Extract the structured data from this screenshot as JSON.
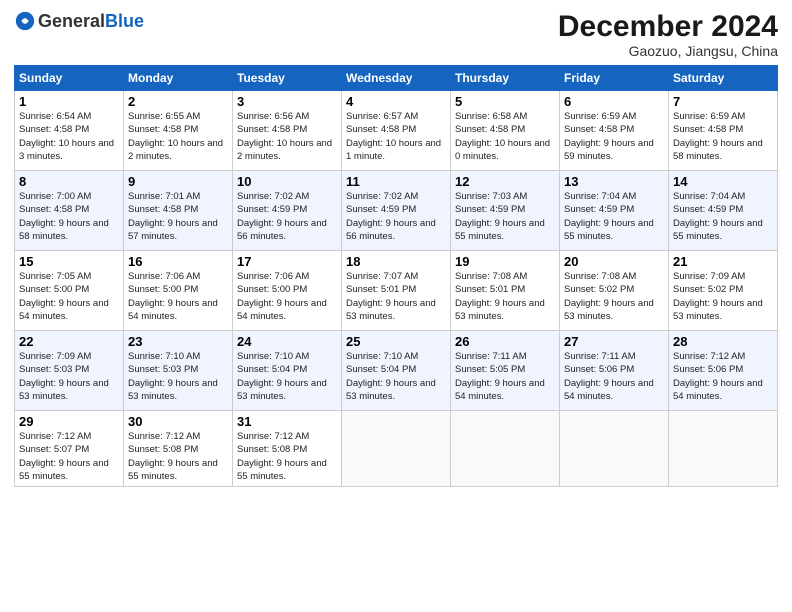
{
  "header": {
    "logo_general": "General",
    "logo_blue": "Blue",
    "month_title": "December 2024",
    "location": "Gaozuo, Jiangsu, China"
  },
  "weekdays": [
    "Sunday",
    "Monday",
    "Tuesday",
    "Wednesday",
    "Thursday",
    "Friday",
    "Saturday"
  ],
  "weeks": [
    [
      {
        "day": 1,
        "sunrise": "6:54 AM",
        "sunset": "4:58 PM",
        "daylight": "10 hours and 3 minutes."
      },
      {
        "day": 2,
        "sunrise": "6:55 AM",
        "sunset": "4:58 PM",
        "daylight": "10 hours and 2 minutes."
      },
      {
        "day": 3,
        "sunrise": "6:56 AM",
        "sunset": "4:58 PM",
        "daylight": "10 hours and 2 minutes."
      },
      {
        "day": 4,
        "sunrise": "6:57 AM",
        "sunset": "4:58 PM",
        "daylight": "10 hours and 1 minute."
      },
      {
        "day": 5,
        "sunrise": "6:58 AM",
        "sunset": "4:58 PM",
        "daylight": "10 hours and 0 minutes."
      },
      {
        "day": 6,
        "sunrise": "6:59 AM",
        "sunset": "4:58 PM",
        "daylight": "9 hours and 59 minutes."
      },
      {
        "day": 7,
        "sunrise": "6:59 AM",
        "sunset": "4:58 PM",
        "daylight": "9 hours and 58 minutes."
      }
    ],
    [
      {
        "day": 8,
        "sunrise": "7:00 AM",
        "sunset": "4:58 PM",
        "daylight": "9 hours and 58 minutes."
      },
      {
        "day": 9,
        "sunrise": "7:01 AM",
        "sunset": "4:58 PM",
        "daylight": "9 hours and 57 minutes."
      },
      {
        "day": 10,
        "sunrise": "7:02 AM",
        "sunset": "4:59 PM",
        "daylight": "9 hours and 56 minutes."
      },
      {
        "day": 11,
        "sunrise": "7:02 AM",
        "sunset": "4:59 PM",
        "daylight": "9 hours and 56 minutes."
      },
      {
        "day": 12,
        "sunrise": "7:03 AM",
        "sunset": "4:59 PM",
        "daylight": "9 hours and 55 minutes."
      },
      {
        "day": 13,
        "sunrise": "7:04 AM",
        "sunset": "4:59 PM",
        "daylight": "9 hours and 55 minutes."
      },
      {
        "day": 14,
        "sunrise": "7:04 AM",
        "sunset": "4:59 PM",
        "daylight": "9 hours and 55 minutes."
      }
    ],
    [
      {
        "day": 15,
        "sunrise": "7:05 AM",
        "sunset": "5:00 PM",
        "daylight": "9 hours and 54 minutes."
      },
      {
        "day": 16,
        "sunrise": "7:06 AM",
        "sunset": "5:00 PM",
        "daylight": "9 hours and 54 minutes."
      },
      {
        "day": 17,
        "sunrise": "7:06 AM",
        "sunset": "5:00 PM",
        "daylight": "9 hours and 54 minutes."
      },
      {
        "day": 18,
        "sunrise": "7:07 AM",
        "sunset": "5:01 PM",
        "daylight": "9 hours and 53 minutes."
      },
      {
        "day": 19,
        "sunrise": "7:08 AM",
        "sunset": "5:01 PM",
        "daylight": "9 hours and 53 minutes."
      },
      {
        "day": 20,
        "sunrise": "7:08 AM",
        "sunset": "5:02 PM",
        "daylight": "9 hours and 53 minutes."
      },
      {
        "day": 21,
        "sunrise": "7:09 AM",
        "sunset": "5:02 PM",
        "daylight": "9 hours and 53 minutes."
      }
    ],
    [
      {
        "day": 22,
        "sunrise": "7:09 AM",
        "sunset": "5:03 PM",
        "daylight": "9 hours and 53 minutes."
      },
      {
        "day": 23,
        "sunrise": "7:10 AM",
        "sunset": "5:03 PM",
        "daylight": "9 hours and 53 minutes."
      },
      {
        "day": 24,
        "sunrise": "7:10 AM",
        "sunset": "5:04 PM",
        "daylight": "9 hours and 53 minutes."
      },
      {
        "day": 25,
        "sunrise": "7:10 AM",
        "sunset": "5:04 PM",
        "daylight": "9 hours and 53 minutes."
      },
      {
        "day": 26,
        "sunrise": "7:11 AM",
        "sunset": "5:05 PM",
        "daylight": "9 hours and 54 minutes."
      },
      {
        "day": 27,
        "sunrise": "7:11 AM",
        "sunset": "5:06 PM",
        "daylight": "9 hours and 54 minutes."
      },
      {
        "day": 28,
        "sunrise": "7:12 AM",
        "sunset": "5:06 PM",
        "daylight": "9 hours and 54 minutes."
      }
    ],
    [
      {
        "day": 29,
        "sunrise": "7:12 AM",
        "sunset": "5:07 PM",
        "daylight": "9 hours and 55 minutes."
      },
      {
        "day": 30,
        "sunrise": "7:12 AM",
        "sunset": "5:08 PM",
        "daylight": "9 hours and 55 minutes."
      },
      {
        "day": 31,
        "sunrise": "7:12 AM",
        "sunset": "5:08 PM",
        "daylight": "9 hours and 55 minutes."
      },
      null,
      null,
      null,
      null
    ]
  ]
}
